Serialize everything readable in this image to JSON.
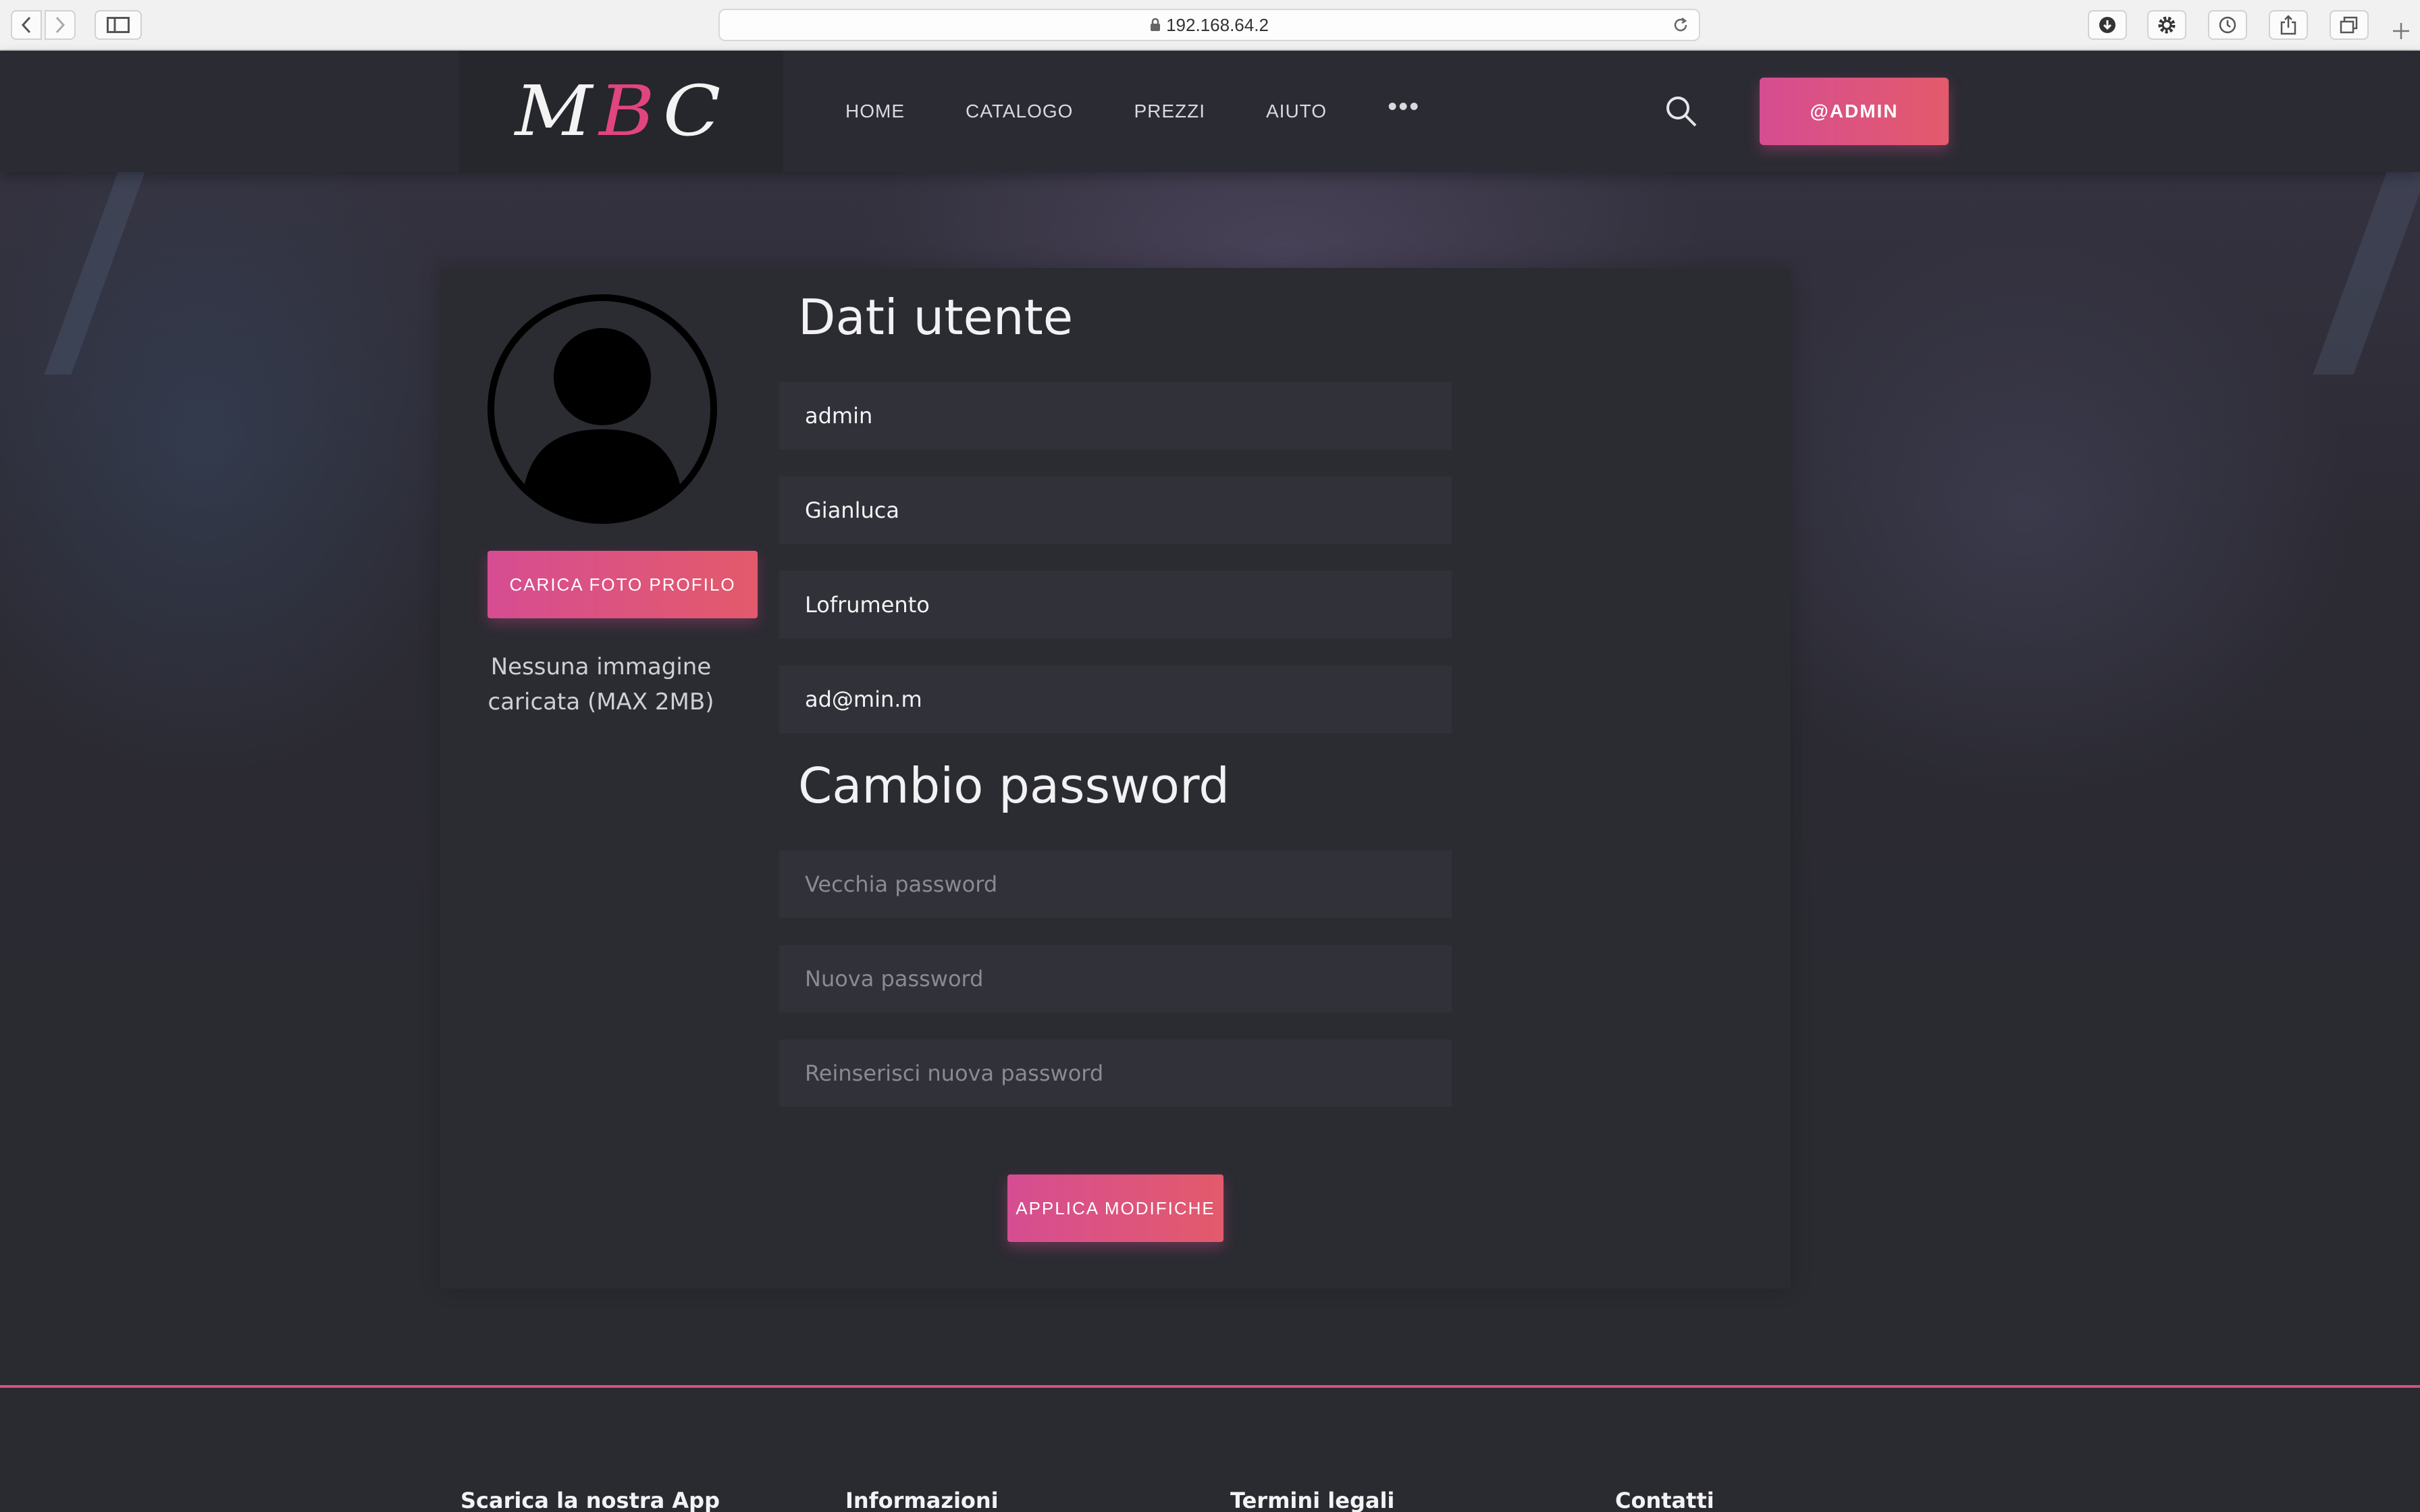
{
  "browser": {
    "url": "192.168.64.2"
  },
  "header": {
    "logo": {
      "part1": "M",
      "part2": "B",
      "part3": "C"
    },
    "nav": [
      "HOME",
      "CATALOGO",
      "PREZZI",
      "AIUTO"
    ],
    "more_label": "•••",
    "account_label": "@ADMIN"
  },
  "profile": {
    "upload_button": "CARICA FOTO PROFILO",
    "upload_note": "Nessuna immagine caricata (MAX 2MB)"
  },
  "user_data": {
    "title": "Dati utente",
    "username": "admin",
    "first_name": "Gianluca",
    "last_name": "Lofrumento",
    "email": "ad@min.m"
  },
  "password_change": {
    "title": "Cambio password",
    "old_placeholder": "Vecchia password",
    "new_placeholder": "Nuova password",
    "repeat_placeholder": "Reinserisci nuova password"
  },
  "apply_button": "APPLICA MODIFICHE",
  "footer": {
    "columns": [
      "Scarica la nostra App",
      "Informazioni",
      "Termini legali",
      "Contatti"
    ]
  },
  "colors": {
    "accent": "#d64d92",
    "accent_end": "#e35a6b",
    "background": "#2a2a31"
  }
}
